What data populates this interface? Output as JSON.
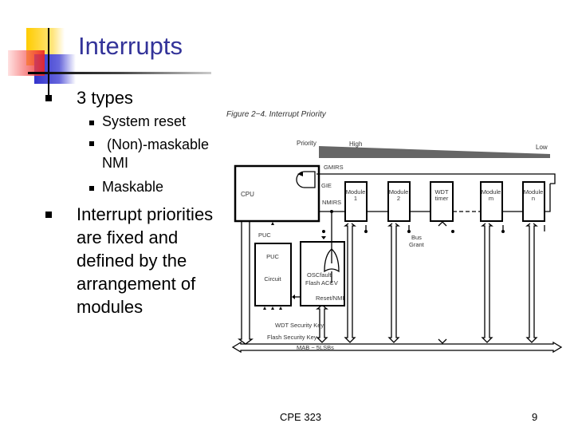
{
  "title": "Interrupts",
  "bullets": [
    {
      "text": "3 types",
      "sub": [
        "System reset",
        "(Non)-maskable NMI",
        "Maskable"
      ]
    },
    {
      "text": "Interrupt priorities are fixed and defined by the arrangement of modules"
    }
  ],
  "figure": {
    "caption": "Figure 2−4. Interrupt Priority",
    "priority": "Priority",
    "high": "High",
    "low": "Low",
    "cpu": "CPU",
    "gmirs": "GMIRS",
    "gie": "GIE",
    "nmirs": "NMIRS",
    "modules": [
      [
        "Module",
        "1"
      ],
      [
        "Module",
        "2"
      ],
      [
        "WDT",
        "timer"
      ],
      [
        "Module",
        "m"
      ],
      [
        "Module",
        "n"
      ]
    ],
    "puc_label": "PUC",
    "puc_box": "PUC",
    "circuit": "Circuit",
    "oscfault": "OSCfault",
    "flash_accv": "Flash ACCV",
    "reset_nmi": "Reset/NMI",
    "bus_grant_1": "Bus",
    "bus_grant_2": "Grant",
    "wdt_key": "WDT Security Key",
    "flash_key": "Flash Security Key",
    "mab": "MAB − 5LSBs"
  },
  "footer": {
    "course": "CPE 323",
    "page": "9"
  }
}
